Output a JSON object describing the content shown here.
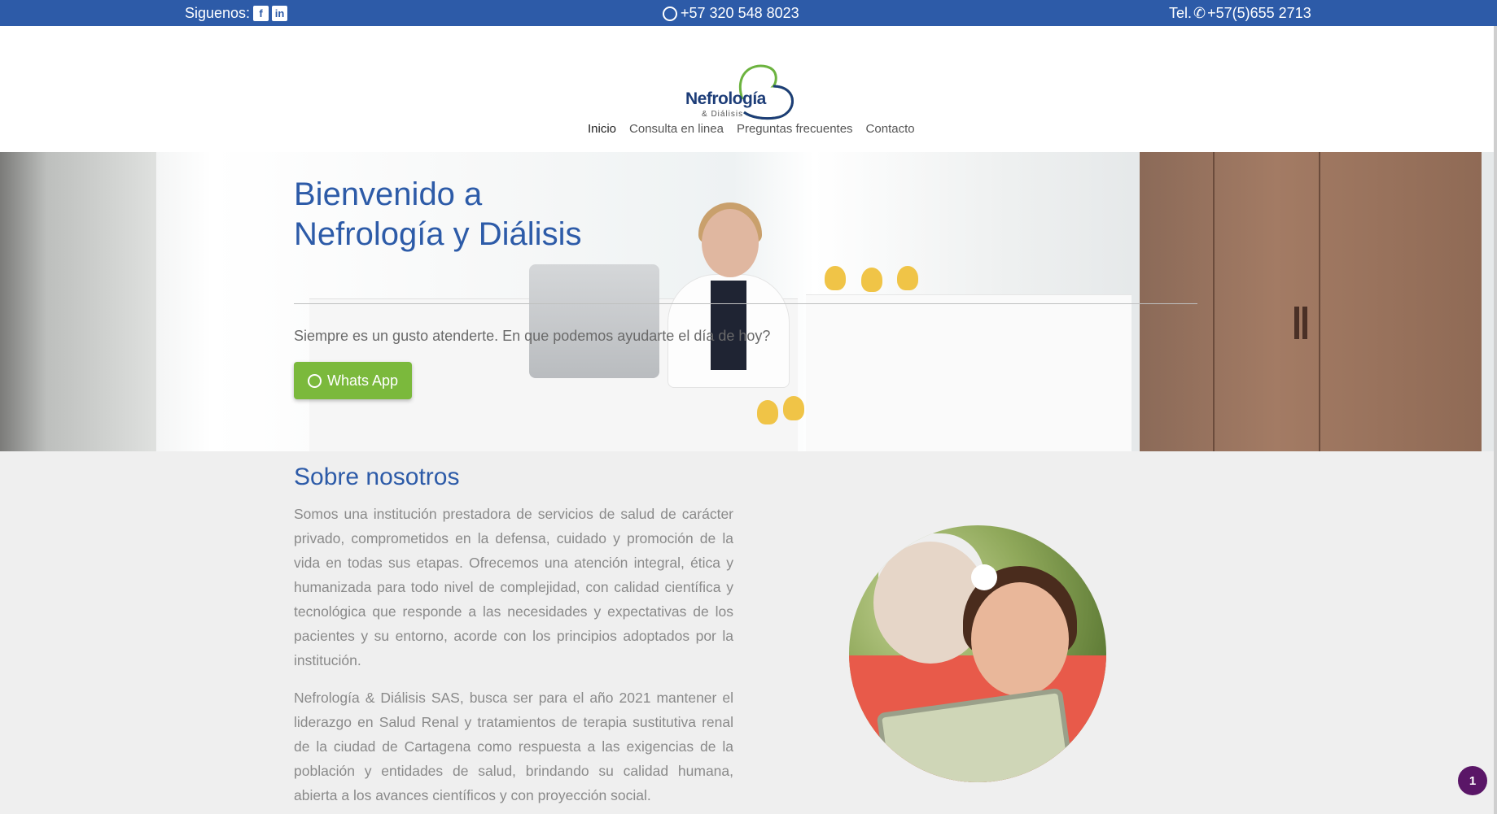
{
  "topbar": {
    "follow_label": "Siguenos:",
    "whatsapp_phone": "+57 320 548 8023",
    "tel_label": "Tel.",
    "tel_number": "+57(5)655 2713",
    "social_icons": [
      "facebook-icon",
      "linkedin-icon"
    ]
  },
  "header": {
    "logo_name": "Nefrología",
    "logo_sub": "& Diálisis"
  },
  "nav": {
    "items": [
      {
        "label": "Inicio",
        "active": true
      },
      {
        "label": "Consulta en linea"
      },
      {
        "label": "Preguntas frecuentes"
      },
      {
        "label": "Contacto"
      }
    ]
  },
  "hero": {
    "title_line1": "Bienvenido a",
    "title_line2": "Nefrología y Diálisis",
    "tagline": "Siempre es un gusto atenderte. En que podemos ayudarte el día de hoy?",
    "whatsapp_button": "Whats App"
  },
  "about": {
    "title": "Sobre nosotros",
    "paragraph1": "Somos una institución prestadora de servicios de salud de carácter privado, comprometidos en la defensa, cuidado y promoción de la vida en todas sus etapas. Ofrecemos una atención integral, ética y humanizada para todo nivel de complejidad, con calidad científica y tecnológica que responde a las necesidades y expectativas de los pacientes y su entorno, acorde con los principios adoptados por la institución.",
    "paragraph2": "Nefrología & Diálisis SAS, busca ser para el año 2021 mantener el liderazgo en Salud Renal y tratamientos de terapia sustitutiva renal de la ciudad de Cartagena como respuesta a las exigencias de la población y entidades de salud, brindando su calidad humana, abierta a los avances científicos y con proyección social."
  },
  "notification_badge": "1",
  "colors": {
    "brand_blue": "#2d5ba8",
    "whatsapp_green": "#7bb93c",
    "badge_purple": "#5a1667"
  }
}
